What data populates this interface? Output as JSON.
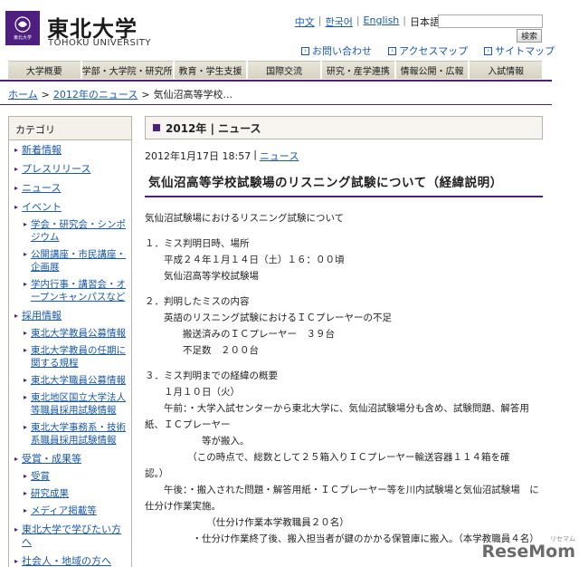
{
  "header": {
    "logo_jp": "東北大学",
    "logo_en": "TOHOKU UNIVERSITY",
    "seal_text": "東北大学"
  },
  "languages": [
    "中文",
    "한국어",
    "English",
    "日本語"
  ],
  "search": {
    "button": "検索",
    "placeholder": ""
  },
  "utility_links": [
    "お問い合わせ",
    "アクセスマップ",
    "サイトマップ"
  ],
  "nav": [
    "大学概要",
    "学部・大学院・研究所",
    "教育・学生支援",
    "国際交流",
    "研究・産学連携",
    "情報公開・広報",
    "入試情報"
  ],
  "breadcrumb": {
    "home": "ホーム",
    "news": "2012年のニュース",
    "current": "気仙沼高等学校..."
  },
  "sidebar": {
    "title": "カテゴリ",
    "items": [
      {
        "label": "新着情報",
        "level": 1
      },
      {
        "label": "プレスリリース",
        "level": 1
      },
      {
        "label": "ニュース",
        "level": 1
      },
      {
        "label": "イベント",
        "level": 1
      },
      {
        "label": "学会・研究会・シンポジウム",
        "level": 2
      },
      {
        "label": "公開講座・市民講座・企画展",
        "level": 2
      },
      {
        "label": "学内行事・講習会・オープンキャンパスなど",
        "level": 2
      },
      {
        "label": "採用情報",
        "level": 1
      },
      {
        "label": "東北大学教員公募情報",
        "level": 2
      },
      {
        "label": "東北大学教員の任期に関する規程",
        "level": 2
      },
      {
        "label": "東北大学職員公募情報",
        "level": 2
      },
      {
        "label": "東北地区国立大学法人等職員採用試験情報",
        "level": 2
      },
      {
        "label": "東北大学事務系・技術系職員採用試験情報",
        "level": 2
      },
      {
        "label": "受賞・成果等",
        "level": 1
      },
      {
        "label": "受賞",
        "level": 2
      },
      {
        "label": "研究成果",
        "level": 2
      },
      {
        "label": "メディア掲載等",
        "level": 2
      },
      {
        "label": "東北大学で学びたい方へ",
        "level": 1
      },
      {
        "label": "社会人・地域の方へ",
        "level": 1
      }
    ]
  },
  "main": {
    "section_title": "2012年 | ニュース",
    "date": "2012年1月17日 18:57",
    "sep": "|",
    "category_link": "ニュース",
    "title": "気仙沼高等学校試験場のリスニング試験について（経緯説明）",
    "lines": [
      "気仙沼試験場におけるリスニング試験について",
      "",
      "１．ミス判明日時、場所",
      "　　平成２４年１月１４日（土）１６：００頃",
      "　　気仙沼高等学校試験場",
      "",
      "２．判明したミスの内容",
      "　　英語のリスニング試験におけるＩＣプレーヤーの不足",
      "　　　　搬送済みのＩＣプレーヤー　３９台",
      "　　　　不足数　２００台",
      "",
      "３．ミス判明までの経緯の概要",
      "　　１月１０日（火）",
      "　　午前：・大学入試センターから東北大学に、気仙沼試験場分も含め、試験問題、解答用",
      "紙、ＩＣプレーヤー",
      "　　　　　　等が搬入。",
      "　　　　　（この時点で、総数として２５箱入りＩＣプレーヤー輸送容器１１４箱を確",
      "認。）",
      "　　午後：・搬入された問題・解答用紙・ＩＣプレーヤー等を川内試験場と気仙沼試験場　に",
      "仕分け作業実施。",
      "　　　　　　　（仕分け作業本学教職員２０名）",
      "　　　　　・仕分け作業終了後、搬入担当者が鍵のかかる保管庫に搬入。（本学教職員４名）"
    ]
  },
  "watermark": {
    "text": "ReseMom",
    "small": "リセマム"
  },
  "colors": {
    "brand": "#4e1f7e",
    "link": "#1a5aa8"
  }
}
